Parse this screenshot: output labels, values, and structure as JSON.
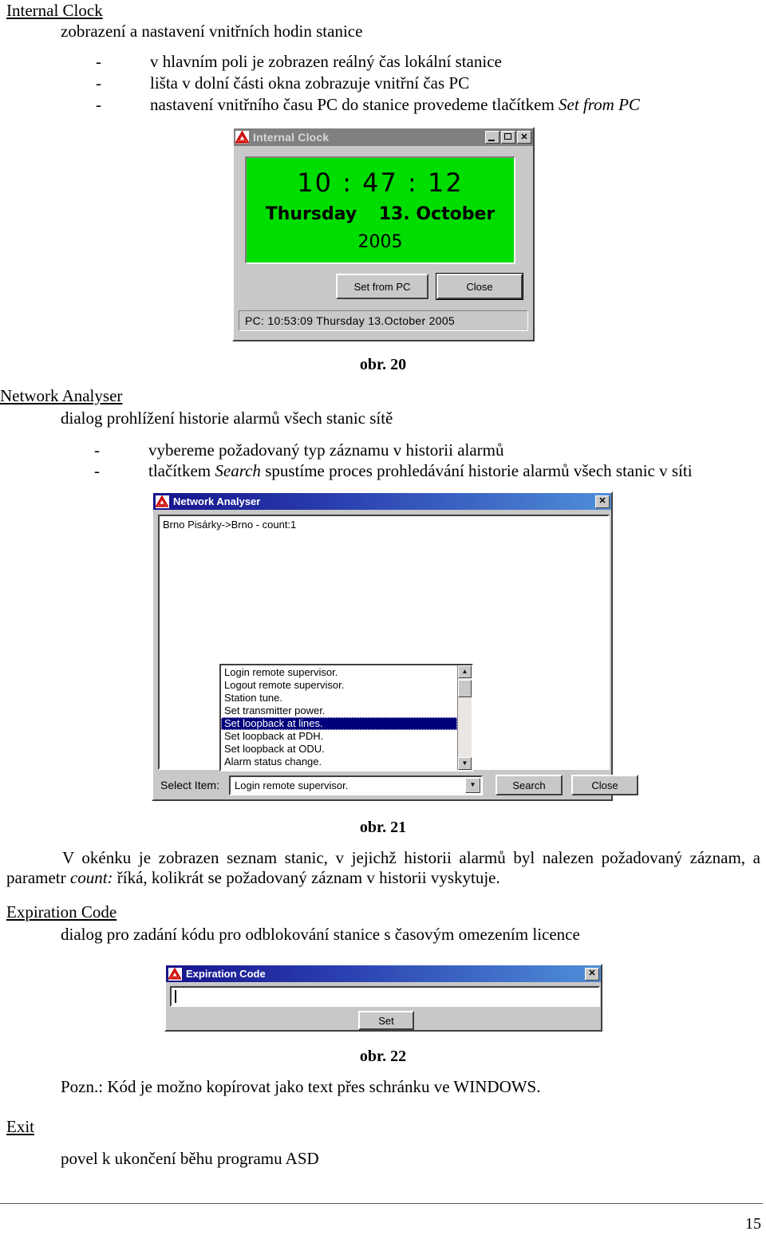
{
  "document": {
    "page_number": "15",
    "sections": [
      {
        "heading": "Internal Clock",
        "subline": "zobrazení a nastavení vnitřních hodin stanice",
        "bullets": [
          "v hlavním poli je zobrazen reálný čas lokální stanice",
          "lišta v dolní části okna zobrazuje vnitřní čas PC",
          "nastavení vnitřního času PC do stanice provedeme tlačítkem "
        ],
        "bullet3_italic": "Set from PC"
      },
      {
        "heading": "Network Analyser",
        "subline": "dialog prohlížení historie alarmů všech stanic sítě",
        "bullet1": "vybereme požadovaný typ záznamu v historii alarmů",
        "bullet2_pre": "tlačítkem ",
        "bullet2_italic": "Search",
        "bullet2_post": " spustíme proces prohledávání historie alarmů všech stanic v síti"
      },
      {
        "heading": "Expiration Code",
        "subline": "dialog pro zadání kódu pro odblokování stanice s časovým omezením licence"
      },
      {
        "heading": "Exit",
        "subline": "povel k ukončení běhu programu ASD"
      }
    ],
    "figure_captions": {
      "fig20": "obr. 20",
      "fig21": "obr. 21",
      "fig22": "obr. 22"
    },
    "paragraphs": {
      "after_fig21_pre": "V okénku je zobrazen seznam stanic, v jejichž historii alarmů byl nalezen požadovaný záznam, a parametr ",
      "after_fig21_italic": "count:",
      "after_fig21_post": " říká, kolikrát se požadovaný záznam v historii vyskytuje.",
      "note_after_fig22": "Pozn.: Kód je možno kopírovat jako text přes schránku ve WINDOWS."
    }
  },
  "internal_clock_dialog": {
    "title": "Internal Clock",
    "icon": "red-triangle-app-icon",
    "minimize_glyph": "_",
    "maximize_glyph": "□",
    "close_glyph": "✕",
    "display": {
      "time": "10 : 47 : 12",
      "weekday": "Thursday",
      "date": "13. October",
      "year": "2005",
      "background_color": "#00dd00"
    },
    "buttons": {
      "set_from_pc": "Set from PC",
      "set_from_pc_accel": "S",
      "close": "Close",
      "close_accel": "C"
    },
    "status_bar": "PC:  10:53:09  Thursday  13.October  2005"
  },
  "network_analyser_dialog": {
    "title": "Network Analyser",
    "icon": "red-triangle-app-icon",
    "close_glyph": "✕",
    "titlebar_color": "#17138c",
    "result_line": "Brno Pisárky->Brno - count:1",
    "listbox": {
      "items": [
        "Login remote supervisor.",
        "Logout remote supervisor.",
        "Station tune.",
        "Set transmitter power.",
        "Set loopback at lines.",
        "Set loopback at PDH.",
        "Set loopback at ODU.",
        "Alarm status change."
      ],
      "selected_index": 4,
      "selected_color": "#00007b",
      "scroll_up_glyph": "▲",
      "scroll_down_glyph": "▼"
    },
    "select_item_label": "Select Item:",
    "combo_value": "Login remote supervisor.",
    "combo_arrow_glyph": "▼",
    "buttons": {
      "search": "Search",
      "search_accel": "S",
      "close": "Close",
      "close_accel": "C"
    }
  },
  "expiration_code_dialog": {
    "title": "Expiration Code",
    "icon": "red-triangle-app-icon",
    "close_glyph": "✕",
    "titlebar_color": "#17138c",
    "input_value": "",
    "buttons": {
      "set": "Set",
      "set_accel": "S"
    }
  }
}
